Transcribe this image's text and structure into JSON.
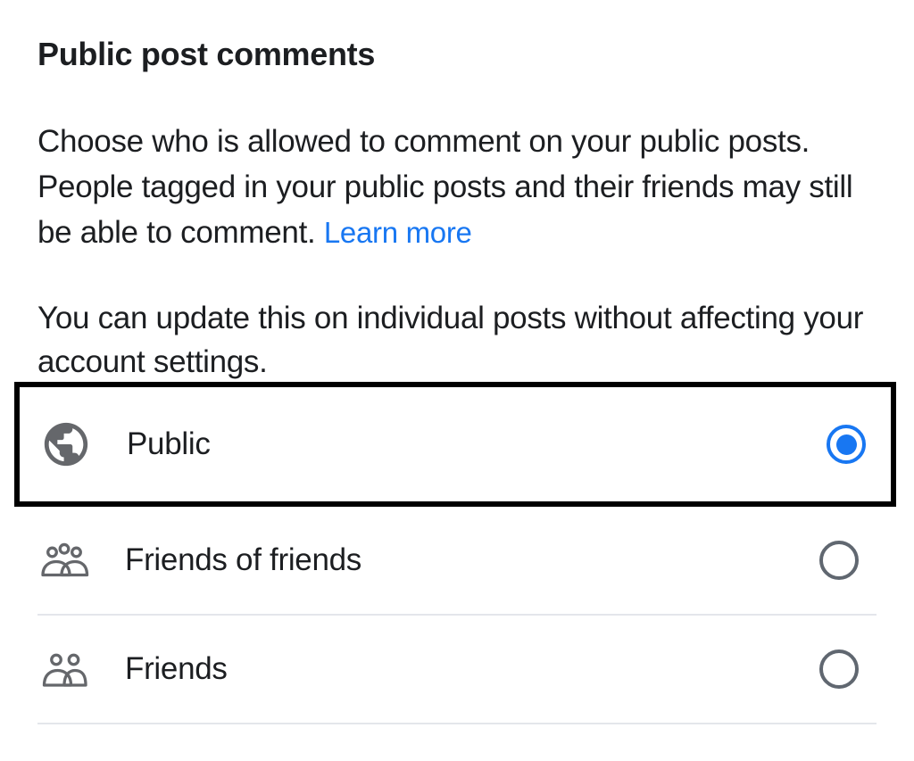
{
  "title": "Public post comments",
  "description_part1": "Choose who is allowed to comment on your public posts. People tagged in your public posts and their friends may still be able to comment. ",
  "learn_more": "Learn more",
  "subdescription": "You can update this on individual posts without affecting your account settings.",
  "options": [
    {
      "label": "Public",
      "selected": true
    },
    {
      "label": "Friends of friends",
      "selected": false
    },
    {
      "label": "Friends",
      "selected": false
    }
  ]
}
